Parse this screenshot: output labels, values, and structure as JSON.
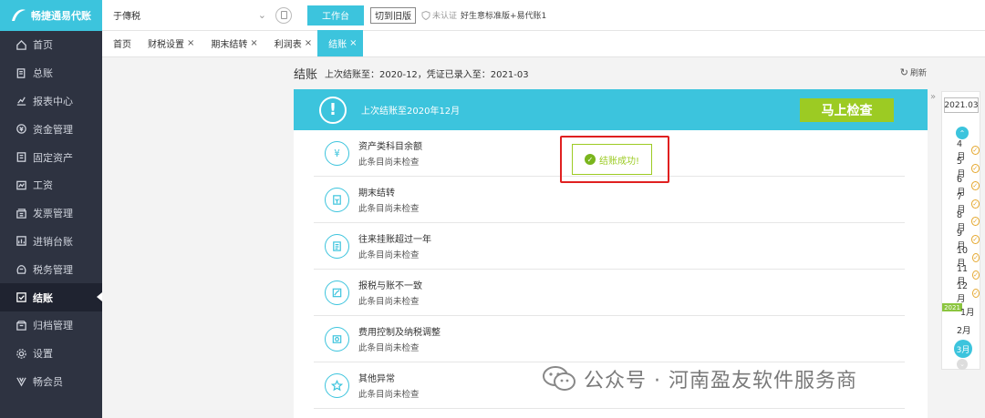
{
  "app": {
    "logo_text": "畅捷通易代账"
  },
  "sidebar": {
    "items": [
      {
        "label": "首页",
        "icon": "home-icon"
      },
      {
        "label": "总账",
        "icon": "ledger-icon"
      },
      {
        "label": "报表中心",
        "icon": "chart-icon"
      },
      {
        "label": "资金管理",
        "icon": "money-icon"
      },
      {
        "label": "固定资产",
        "icon": "building-icon"
      },
      {
        "label": "工资",
        "icon": "salary-icon"
      },
      {
        "label": "发票管理",
        "icon": "invoice-icon"
      },
      {
        "label": "进销台账",
        "icon": "stock-icon"
      },
      {
        "label": "税务管理",
        "icon": "tax-icon"
      },
      {
        "label": "结账",
        "icon": "closing-icon",
        "active": true
      },
      {
        "label": "归档管理",
        "icon": "archive-icon"
      },
      {
        "label": "设置",
        "icon": "gear-icon"
      },
      {
        "label": "畅会员",
        "icon": "vip-icon"
      }
    ]
  },
  "topbar": {
    "company": "于傳税",
    "workbench_label": "工作台",
    "old_version_label": "切到旧版",
    "cert_text": "未认证",
    "edition_text": "好生意标准版+易代账1"
  },
  "tabs": [
    {
      "label": "首页",
      "closable": false
    },
    {
      "label": "财税设置",
      "closable": true
    },
    {
      "label": "期末结转",
      "closable": true
    },
    {
      "label": "利润表",
      "closable": true
    },
    {
      "label": "结账",
      "closable": true,
      "active": true
    }
  ],
  "page": {
    "title": "结账",
    "subtitle": "上次结账至：2020-12，凭证已录入至：2021-03",
    "refresh_label": "刷新"
  },
  "banner": {
    "text": "上次结账至2020年12月",
    "check_button": "马上检查"
  },
  "checks": [
    {
      "title": "资产类科目余额",
      "status": "此条目尚未检查",
      "icon": "yen-icon"
    },
    {
      "title": "期末结转",
      "status": "此条目尚未检查",
      "icon": "transfer-icon"
    },
    {
      "title": "往来挂账超过一年",
      "status": "此条目尚未检查",
      "icon": "document-icon"
    },
    {
      "title": "报税与账不一致",
      "status": "此条目尚未检查",
      "icon": "report-icon"
    },
    {
      "title": "费用控制及纳税调整",
      "status": "此条目尚未检查",
      "icon": "expense-icon"
    },
    {
      "title": "其他异常",
      "status": "此条目尚未检查",
      "icon": "star-icon"
    }
  ],
  "toast": {
    "text": "结账成功!"
  },
  "month_rail": {
    "period": "2021.03",
    "months_checked": [
      "4月",
      "5月",
      "6月",
      "7月",
      "8月",
      "9月",
      "10月",
      "11月",
      "12月"
    ],
    "year_badge": "2021",
    "months_plain": [
      "1月",
      "2月"
    ],
    "current_month": "3月"
  },
  "watermark": {
    "text": "公众号 · 河南盈友软件服务商"
  },
  "colors": {
    "accent": "#3cc4dd",
    "success": "#9ccb23",
    "sidebar": "#2e3341",
    "highlight": "#e02020"
  }
}
